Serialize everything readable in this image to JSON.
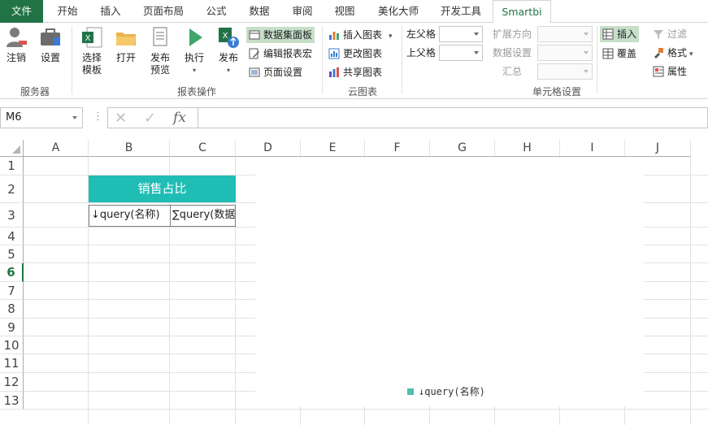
{
  "tabs": [
    "文件",
    "开始",
    "插入",
    "页面布局",
    "公式",
    "数据",
    "审阅",
    "视图",
    "美化大师",
    "开发工具",
    "Smartbi"
  ],
  "ribbon": {
    "groups": {
      "server": "服务器",
      "report_ops": "报表操作",
      "cloud_chart": "云图表",
      "cell_settings": "单元格设置"
    },
    "buttons": {
      "logout": "注销",
      "settings": "设置",
      "select_template_1": "选择",
      "select_template_2": "模板",
      "open": "打开",
      "publish_preview_1": "发布",
      "publish_preview_2": "预览",
      "execute": "执行",
      "publish": "发布",
      "dataset_panel": "数据集面板",
      "edit_report_macro": "编辑报表宏",
      "page_setup": "页面设置",
      "insert_chart": "插入图表",
      "change_chart": "更改图表",
      "share_chart": "共享图表",
      "left_parent": "左父格",
      "upper_parent": "上父格",
      "expand_direction": "扩展方向",
      "data_settings": "数据设置",
      "summary": "汇总",
      "insert": "插入",
      "overwrite": "覆盖",
      "filter": "过滤",
      "format": "格式",
      "properties": "属性"
    }
  },
  "formula_bar": {
    "name_box": "M6",
    "fx": "fx",
    "cancel": "✕",
    "confirm": "✓",
    "more": "⋮",
    "value": ""
  },
  "sheet": {
    "columns": [
      "A",
      "B",
      "C",
      "D",
      "E",
      "F",
      "G",
      "H",
      "I",
      "J"
    ],
    "rows": [
      "1",
      "2",
      "3",
      "4",
      "5",
      "6",
      "7",
      "8",
      "9",
      "10",
      "11",
      "12",
      "13"
    ],
    "selected_row": "6",
    "title_cell": "销售占比",
    "header_b3": "↓query(名称)",
    "header_c3": "∑query(数据)"
  },
  "chart": {
    "legend": [
      {
        "label": "↓query(名称)",
        "color": "#4dbdb5"
      }
    ]
  },
  "colors": {
    "accent": "#217346",
    "title_fill": "#20bdb5",
    "highlight": "#c6dfc9"
  }
}
